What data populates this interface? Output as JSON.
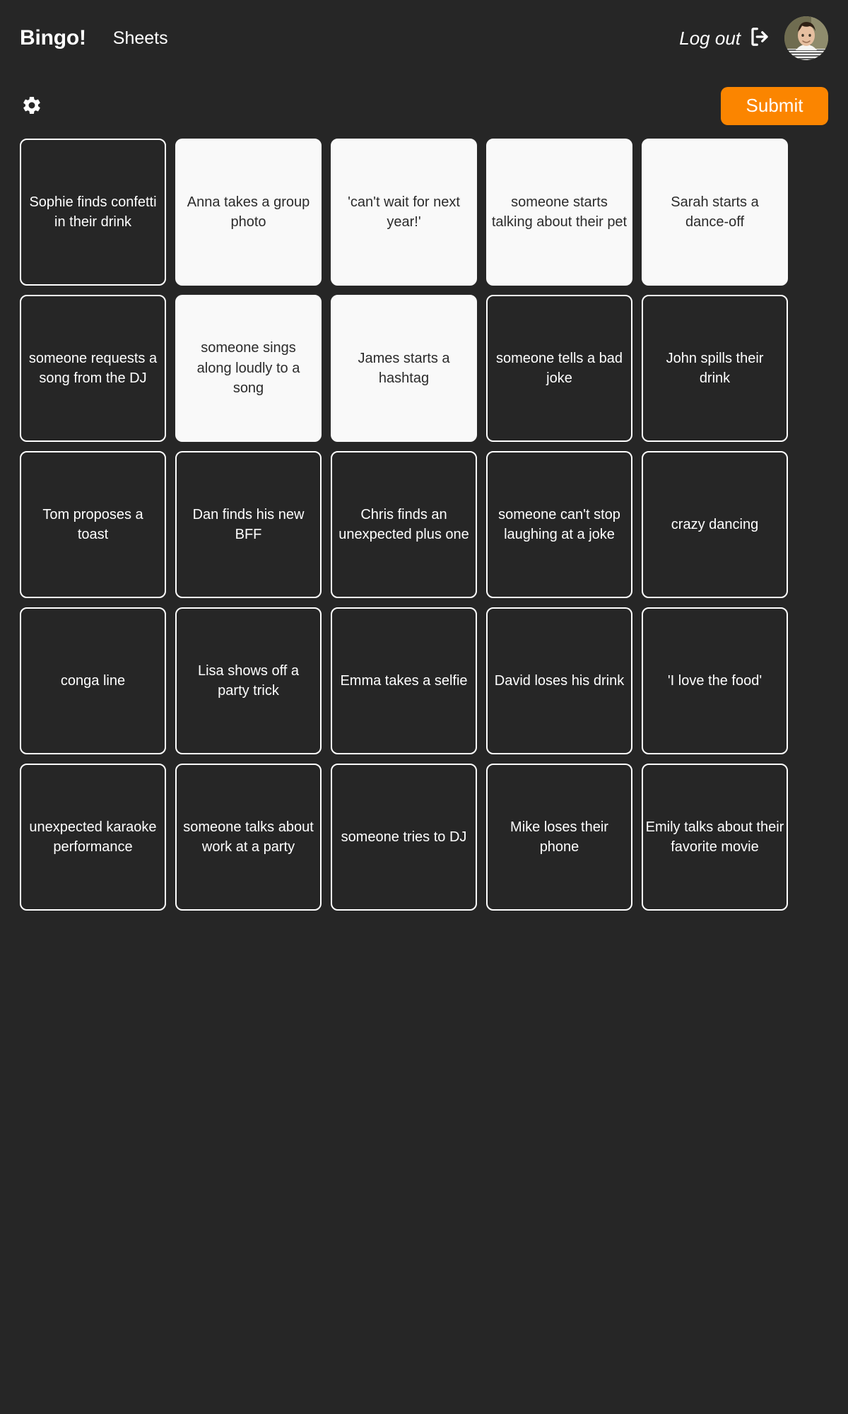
{
  "header": {
    "brand": "Bingo!",
    "nav_link": "Sheets",
    "logout_label": "Log out",
    "logout_icon": "logout-arrow-icon",
    "avatar_icon": "user-avatar"
  },
  "toolbar": {
    "settings_icon": "gear-icon",
    "submit_label": "Submit",
    "submit_color": "#fb8500"
  },
  "colors": {
    "background": "#262626",
    "cell_unselected_bg": "#262626",
    "cell_selected_bg": "#f9f9f9",
    "border": "#ffffff",
    "text_light": "#ffffff",
    "text_dark": "#2b2b2b",
    "accent": "#fb8500"
  },
  "board": {
    "rows": 5,
    "columns": 5,
    "cells": [
      {
        "text": "Sophie finds confetti in their drink",
        "selected": false,
        "wide": false
      },
      {
        "text": "Anna takes a group photo",
        "selected": true,
        "wide": false
      },
      {
        "text": "'can't wait for next year!'",
        "selected": true,
        "wide": true
      },
      {
        "text": "someone starts talking about their pet",
        "selected": true,
        "wide": true
      },
      {
        "text": "Sarah starts a dance-off",
        "selected": true,
        "wide": false
      },
      {
        "text": "someone requests a song from the DJ",
        "selected": false,
        "wide": true
      },
      {
        "text": "someone sings along loudly to a song",
        "selected": true,
        "wide": false
      },
      {
        "text": "James starts a hashtag",
        "selected": true,
        "wide": false
      },
      {
        "text": "someone tells a bad joke",
        "selected": false,
        "wide": false
      },
      {
        "text": "John spills their drink",
        "selected": false,
        "wide": false
      },
      {
        "text": "Tom proposes a toast",
        "selected": false,
        "wide": false
      },
      {
        "text": "Dan finds his new BFF",
        "selected": false,
        "wide": true
      },
      {
        "text": "Chris finds an unexpected plus one",
        "selected": false,
        "wide": false
      },
      {
        "text": "someone can't stop laughing at a joke",
        "selected": false,
        "wide": false
      },
      {
        "text": "crazy dancing",
        "selected": false,
        "wide": false
      },
      {
        "text": "conga line",
        "selected": false,
        "wide": false
      },
      {
        "text": "Lisa shows off a party trick",
        "selected": false,
        "wide": false
      },
      {
        "text": "Emma takes a selfie",
        "selected": false,
        "wide": false
      },
      {
        "text": "David loses his drink",
        "selected": false,
        "wide": false
      },
      {
        "text": "'I love the food'",
        "selected": false,
        "wide": false
      },
      {
        "text": "unexpected karaoke performance",
        "selected": false,
        "wide": false
      },
      {
        "text": "someone talks about work at a party",
        "selected": false,
        "wide": false
      },
      {
        "text": "someone tries to DJ",
        "selected": false,
        "wide": false
      },
      {
        "text": "Mike loses their phone",
        "selected": false,
        "wide": false
      },
      {
        "text": "Emily talks about their favorite movie",
        "selected": false,
        "wide": true
      }
    ]
  }
}
